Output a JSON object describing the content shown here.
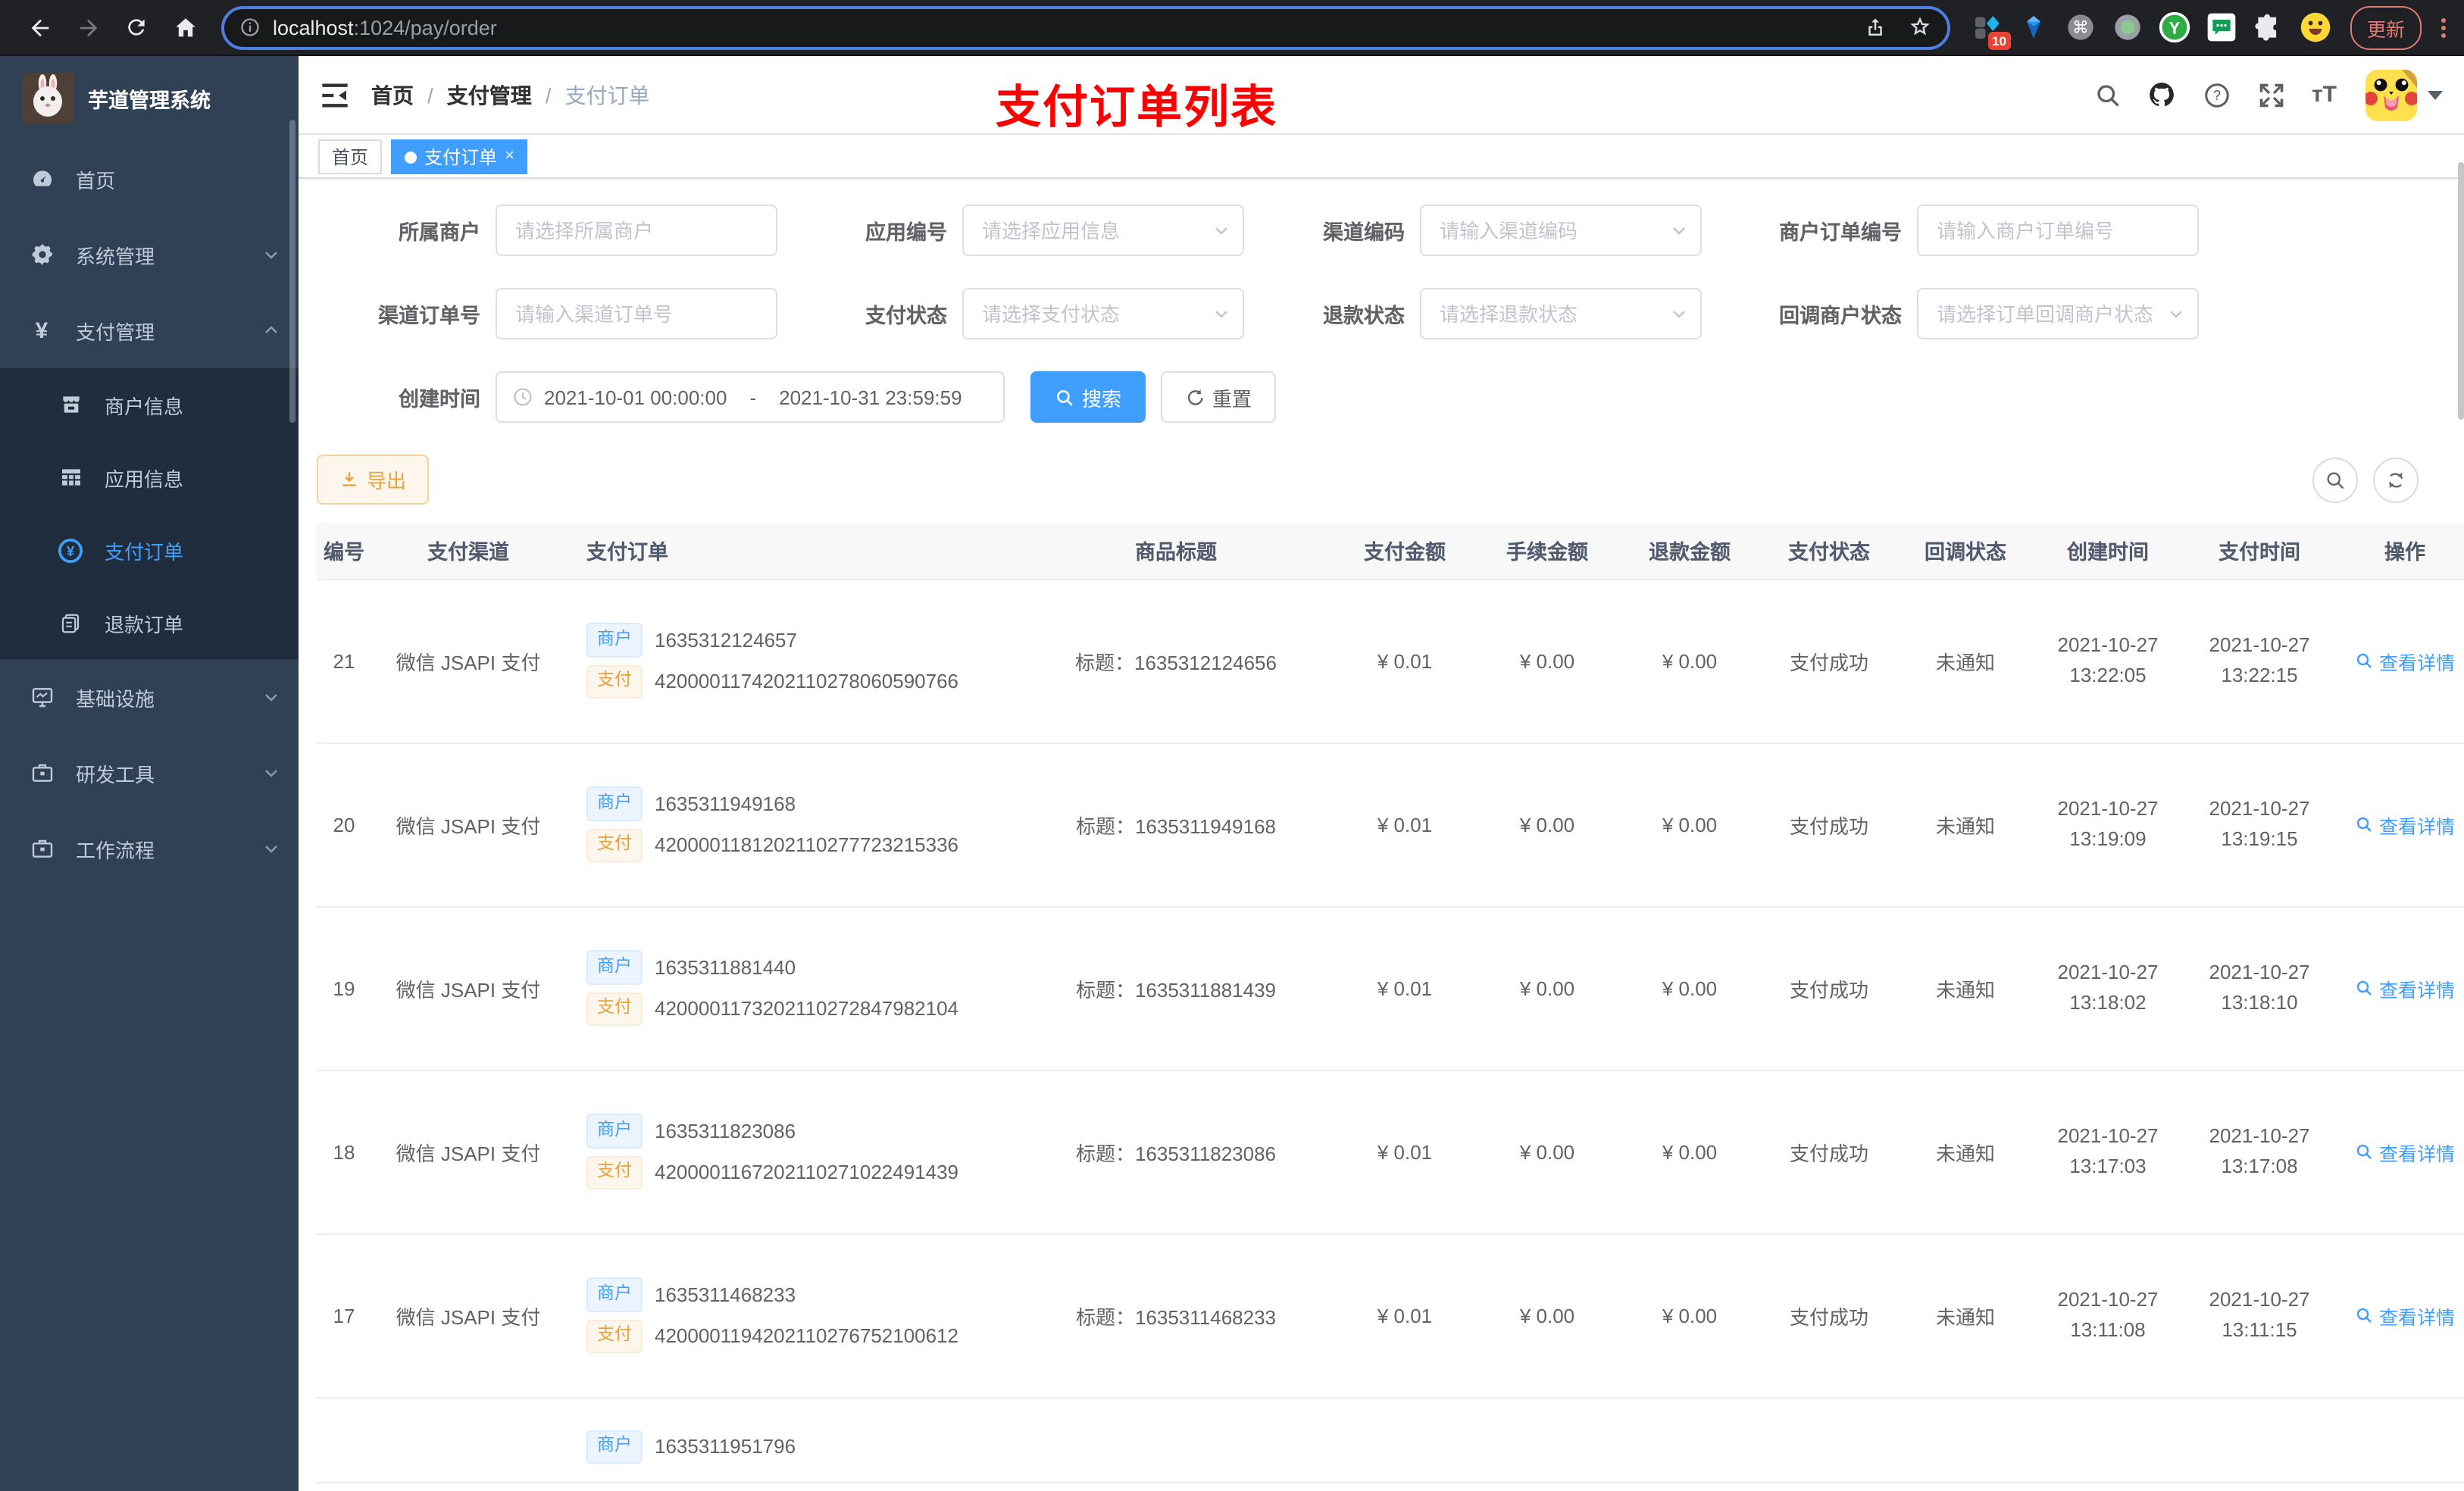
{
  "colors": {
    "accent": "#409eff",
    "warning": "#e6a23c",
    "annotation": "#ff0000",
    "sidebar_bg": "#304156",
    "submenu_bg": "#1f2d3d"
  },
  "browser": {
    "url": {
      "host": "localhost",
      "rest": ":1024/pay/order"
    },
    "extension_badge": "10",
    "update_button": "更新"
  },
  "sidebar": {
    "title": "芋道管理系统",
    "menu": [
      {
        "label": "首页"
      },
      {
        "label": "系统管理"
      },
      {
        "label": "支付管理"
      },
      {
        "label": "商户信息"
      },
      {
        "label": "应用信息"
      },
      {
        "label": "支付订单"
      },
      {
        "label": "退款订单"
      },
      {
        "label": "基础设施"
      },
      {
        "label": "研发工具"
      },
      {
        "label": "工作流程"
      }
    ]
  },
  "navbar": {
    "breadcrumb": [
      "首页",
      "支付管理",
      "支付订单"
    ],
    "separator": "/",
    "annotation": "支付订单列表"
  },
  "tags": {
    "home": "首页",
    "current": "支付订单",
    "close": "×"
  },
  "filters": {
    "fields": [
      {
        "label": "所属商户",
        "placeholder": "请选择所属商户"
      },
      {
        "label": "应用编号",
        "placeholder": "请选择应用信息"
      },
      {
        "label": "渠道编码",
        "placeholder": "请输入渠道编码"
      },
      {
        "label": "商户订单编号",
        "placeholder": "请输入商户订单编号"
      },
      {
        "label": "渠道订单号",
        "placeholder": "请输入渠道订单号"
      },
      {
        "label": "支付状态",
        "placeholder": "请选择支付状态"
      },
      {
        "label": "退款状态",
        "placeholder": "请选择退款状态"
      },
      {
        "label": "回调商户状态",
        "placeholder": "请选择订单回调商户状态"
      }
    ],
    "date": {
      "label": "创建时间",
      "start": "2021-10-01 00:00:00",
      "separator": "-",
      "end": "2021-10-31 23:59:59"
    },
    "search": "搜索",
    "reset": "重置"
  },
  "toolbar": {
    "export": "导出"
  },
  "table": {
    "headers": [
      "编号",
      "支付渠道",
      "支付订单",
      "商品标题",
      "支付金额",
      "手续金额",
      "退款金额",
      "支付状态",
      "回调状态",
      "创建时间",
      "支付时间",
      "操作"
    ],
    "tag_merchant": "商户",
    "tag_pay": "支付",
    "action": "查看详情",
    "rows": [
      {
        "id": "21",
        "channel": "微信 JSAPI 支付",
        "merchant_no": "1635312124657",
        "pay_no": "4200001174202110278060590766",
        "title": "标题：1635312124656",
        "amount": "¥ 0.01",
        "fee": "¥ 0.00",
        "refund": "¥ 0.00",
        "status": "支付成功",
        "notify": "未通知",
        "created_date": "2021-10-27",
        "created_time": "13:22:05",
        "paid_date": "2021-10-27",
        "paid_time": "13:22:15"
      },
      {
        "id": "20",
        "channel": "微信 JSAPI 支付",
        "merchant_no": "1635311949168",
        "pay_no": "4200001181202110277723215336",
        "title": "标题：1635311949168",
        "amount": "¥ 0.01",
        "fee": "¥ 0.00",
        "refund": "¥ 0.00",
        "status": "支付成功",
        "notify": "未通知",
        "created_date": "2021-10-27",
        "created_time": "13:19:09",
        "paid_date": "2021-10-27",
        "paid_time": "13:19:15"
      },
      {
        "id": "19",
        "channel": "微信 JSAPI 支付",
        "merchant_no": "1635311881440",
        "pay_no": "4200001173202110272847982104",
        "title": "标题：1635311881439",
        "amount": "¥ 0.01",
        "fee": "¥ 0.00",
        "refund": "¥ 0.00",
        "status": "支付成功",
        "notify": "未通知",
        "created_date": "2021-10-27",
        "created_time": "13:18:02",
        "paid_date": "2021-10-27",
        "paid_time": "13:18:10"
      },
      {
        "id": "18",
        "channel": "微信 JSAPI 支付",
        "merchant_no": "1635311823086",
        "pay_no": "4200001167202110271022491439",
        "title": "标题：1635311823086",
        "amount": "¥ 0.01",
        "fee": "¥ 0.00",
        "refund": "¥ 0.00",
        "status": "支付成功",
        "notify": "未通知",
        "created_date": "2021-10-27",
        "created_time": "13:17:03",
        "paid_date": "2021-10-27",
        "paid_time": "13:17:08"
      },
      {
        "id": "17",
        "channel": "微信 JSAPI 支付",
        "merchant_no": "1635311468233",
        "pay_no": "4200001194202110276752100612",
        "title": "标题：1635311468233",
        "amount": "¥ 0.01",
        "fee": "¥ 0.00",
        "refund": "¥ 0.00",
        "status": "支付成功",
        "notify": "未通知",
        "created_date": "2021-10-27",
        "created_time": "13:11:08",
        "paid_date": "2021-10-27",
        "paid_time": "13:11:15"
      },
      {
        "partial": true,
        "merchant_no": "1635311951796"
      }
    ]
  }
}
